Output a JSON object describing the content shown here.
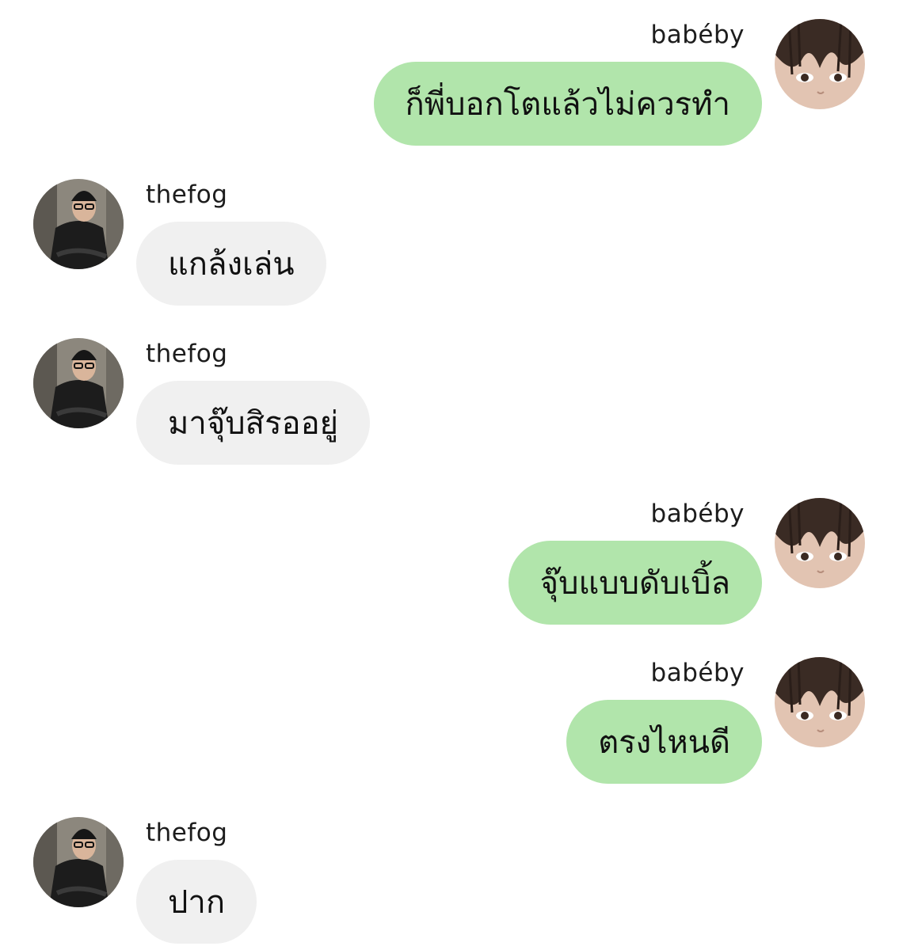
{
  "chat": {
    "messages": [
      {
        "sender": "babéby",
        "side": "out",
        "text": "ก็พี่บอกโตแล้วไม่ควรทำ"
      },
      {
        "sender": "thefog",
        "side": "in",
        "text": "แกล้งเล่น"
      },
      {
        "sender": "thefog",
        "side": "in",
        "text": "มาจุ๊บสิรออยู่"
      },
      {
        "sender": "babéby",
        "side": "out",
        "text": "จุ๊บแบบดับเบิ้ล"
      },
      {
        "sender": "babéby",
        "side": "out",
        "text": "ตรงไหนดี"
      },
      {
        "sender": "thefog",
        "side": "in",
        "text": "ปาก"
      }
    ]
  },
  "colors": {
    "outgoing_bubble": "#b1e5ab",
    "incoming_bubble": "#f0f0f0",
    "background": "#ffffff"
  }
}
